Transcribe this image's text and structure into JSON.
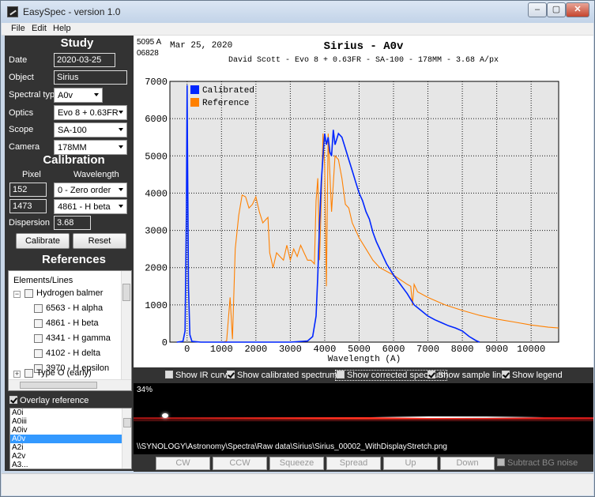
{
  "window": {
    "title": "EasySpec - version 1.0",
    "min_label": "‒",
    "max_label": "▢",
    "close_label": "✕"
  },
  "menu": {
    "file": "File",
    "edit": "Edit",
    "help": "Help"
  },
  "study": {
    "heading": "Study",
    "date_label": "Date",
    "date_value": "2020-03-25",
    "object_label": "Object",
    "object_value": "Sirius",
    "spectral_label": "Spectral type",
    "spectral_value": "A0v",
    "optics_label": "Optics",
    "optics_value": "Evo 8 + 0.63FR",
    "scope_label": "Scope",
    "scope_value": "SA-100",
    "camera_label": "Camera",
    "camera_value": "178MM"
  },
  "calibration": {
    "heading": "Calibration",
    "pixel_header": "Pixel",
    "wavelength_header": "Wavelength",
    "pixel1": "152",
    "wave1": "0 - Zero order",
    "pixel2": "1473",
    "wave2": "4861 - H beta",
    "dispersion_label": "Dispersion",
    "dispersion_value": "3.68",
    "calibrate_label": "Calibrate",
    "reset_label": "Reset"
  },
  "references": {
    "heading": "References",
    "tree_header": "Elements/Lines",
    "group1": "Hydrogen balmer",
    "lines": [
      "6563 - H alpha",
      "4861 - H beta",
      "4341 - H gamma",
      "4102 - H delta",
      "3970 - H epsilon"
    ],
    "group2": "Type O (early)",
    "overlay_label": "Overlay reference",
    "ref_list": [
      "A0i",
      "A0iii",
      "A0iv",
      "A0v",
      "A2i",
      "A2v",
      "A3..."
    ],
    "selected": "A0v"
  },
  "chart_header": {
    "corner1": "5095 A",
    "corner2": "06828",
    "date": "Mar 25, 2020",
    "title": "Sirius - A0v",
    "subtitle": "David Scott - Evo 8 + 0.63FR - SA-100 - 178MM - 3.68 A/px"
  },
  "chart_data": {
    "type": "line",
    "title": "Sirius - A0v",
    "xlabel": "Wavelength (A)",
    "ylabel": "",
    "xlim": [
      -500,
      10800
    ],
    "ylim": [
      0,
      7000
    ],
    "xticks": [
      0,
      1000,
      2000,
      3000,
      4000,
      5000,
      6000,
      7000,
      8000,
      9000,
      10000
    ],
    "yticks": [
      0,
      1000,
      2000,
      3000,
      4000,
      5000,
      6000,
      7000
    ],
    "grid": true,
    "legend_position": "top-left",
    "series": [
      {
        "name": "Calibrated",
        "color": "#0026ff",
        "x": [
          -300,
          -120,
          -60,
          -20,
          0,
          10,
          40,
          80,
          140,
          400,
          1000,
          2000,
          3000,
          3500,
          3650,
          3750,
          3800,
          3850,
          3900,
          3950,
          4000,
          4050,
          4100,
          4150,
          4200,
          4250,
          4300,
          4400,
          4500,
          4600,
          4700,
          4800,
          4900,
          5000,
          5100,
          5200,
          5300,
          5400,
          5500,
          5600,
          5700,
          5800,
          5900,
          6000,
          6200,
          6400,
          6600,
          6800,
          7000,
          7200,
          7400,
          7600,
          7800,
          8000,
          8200,
          8400,
          8500
        ],
        "y": [
          0,
          20,
          300,
          3500,
          6900,
          5500,
          1500,
          200,
          20,
          0,
          0,
          0,
          0,
          30,
          150,
          700,
          1800,
          3200,
          4300,
          5000,
          5600,
          5300,
          5500,
          5100,
          5000,
          5700,
          5300,
          5600,
          5500,
          5200,
          4900,
          4600,
          4300,
          4000,
          3800,
          3500,
          3300,
          2950,
          2700,
          2500,
          2300,
          2100,
          1950,
          1800,
          1550,
          1300,
          1000,
          850,
          700,
          600,
          520,
          440,
          380,
          300,
          150,
          40,
          0
        ]
      },
      {
        "name": "Reference",
        "color": "#ff8000",
        "x": [
          1000,
          1050,
          1150,
          1250,
          1320,
          1400,
          1500,
          1600,
          1700,
          1800,
          1900,
          2000,
          2100,
          2200,
          2300,
          2350,
          2400,
          2500,
          2600,
          2700,
          2800,
          2900,
          3000,
          3100,
          3200,
          3300,
          3400,
          3500,
          3600,
          3700,
          3750,
          3800,
          3850,
          3900,
          3950,
          4000,
          4050,
          4100,
          4150,
          4200,
          4300,
          4400,
          4500,
          4600,
          4700,
          4800,
          5000,
          5200,
          5400,
          5600,
          6000,
          6400,
          6500,
          6550,
          6600,
          6700,
          7000,
          7500,
          8000,
          8500,
          9000,
          9500,
          10000,
          10500,
          10800
        ],
        "y": [
          10,
          0,
          30,
          1200,
          80,
          2500,
          3400,
          3950,
          3900,
          3600,
          3700,
          3900,
          3500,
          3200,
          3300,
          3350,
          2400,
          2000,
          2400,
          2300,
          2200,
          2600,
          2200,
          2500,
          2300,
          2600,
          2400,
          2200,
          2200,
          2100,
          3800,
          4400,
          2200,
          3800,
          5600,
          4700,
          1500,
          5600,
          4500,
          3500,
          5000,
          4900,
          4400,
          3700,
          3600,
          3200,
          2800,
          2500,
          2200,
          2000,
          1800,
          1550,
          1500,
          1000,
          1550,
          1350,
          1200,
          1000,
          850,
          720,
          620,
          540,
          460,
          400,
          380
        ]
      }
    ]
  },
  "options": {
    "ir": "Show IR curve",
    "calibrated": "Show calibrated spectrum",
    "corrected": "Show corrected spectrum",
    "sample": "Show sample lines",
    "legend": "Show legend"
  },
  "image": {
    "zoom": "34%",
    "path": "\\\\SYNOLOGY\\Astronomy\\Spectra\\Raw data\\Sirius\\Sirius_00002_WithDisplayStretch.png"
  },
  "controls": {
    "cw": "CW",
    "ccw": "CCW",
    "squeeze": "Squeeze",
    "spread": "Spread",
    "up": "Up",
    "down": "Down",
    "subtract": "Subtract BG noise"
  }
}
